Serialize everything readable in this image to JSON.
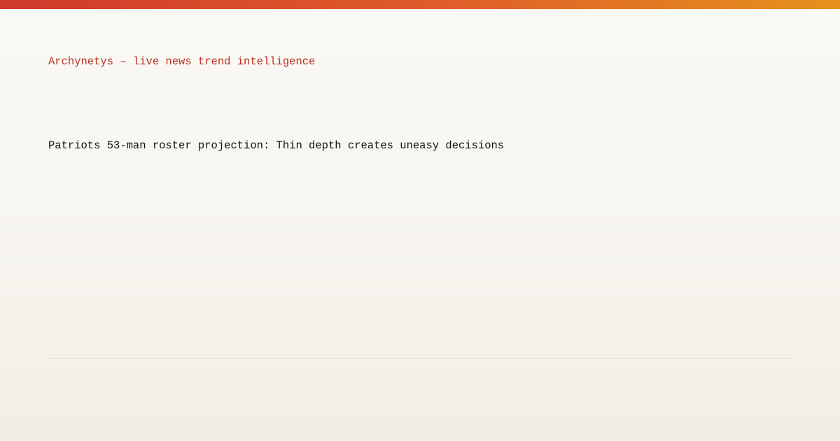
{
  "brand": {
    "tagline": "Archynetys – live news trend intelligence",
    "accent_gradient": [
      "#cf3a2c",
      "#df5a2a",
      "#e5921c"
    ]
  },
  "article": {
    "headline": "Patriots 53-man roster projection: Thin depth creates uneasy decisions"
  },
  "colors": {
    "background": "#f8f6f1",
    "brand_text": "#b83024",
    "headline_text": "#111111",
    "divider": "#e4dfd8"
  }
}
